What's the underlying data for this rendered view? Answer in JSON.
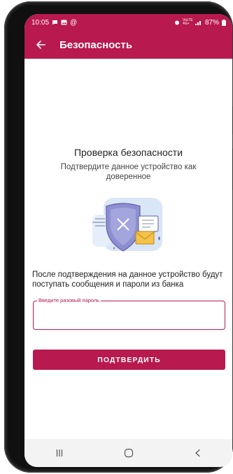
{
  "status_bar": {
    "time": "10:05",
    "network_label": "VoLTE 4G+",
    "battery": "87%",
    "bg_color": "#b8194f"
  },
  "app_bar": {
    "title": "Безопасность",
    "back_icon": "arrow-left-icon"
  },
  "main": {
    "heading": "Проверка безопасности",
    "subheading": "Подтвердите данное устройство как доверенное",
    "illustration": "shield-envelope-illustration",
    "info_text": "После подтверждения на данное устройство будут поступать сообщения и пароли из банка"
  },
  "otp_field": {
    "label": "Введите разовый пароль",
    "value": ""
  },
  "confirm_button": {
    "label": "ПОДТВЕРДИТЬ"
  },
  "nav_bar": {
    "icons": [
      "recent-apps-icon",
      "home-icon",
      "back-icon"
    ]
  },
  "colors": {
    "accent": "#b8194f"
  }
}
